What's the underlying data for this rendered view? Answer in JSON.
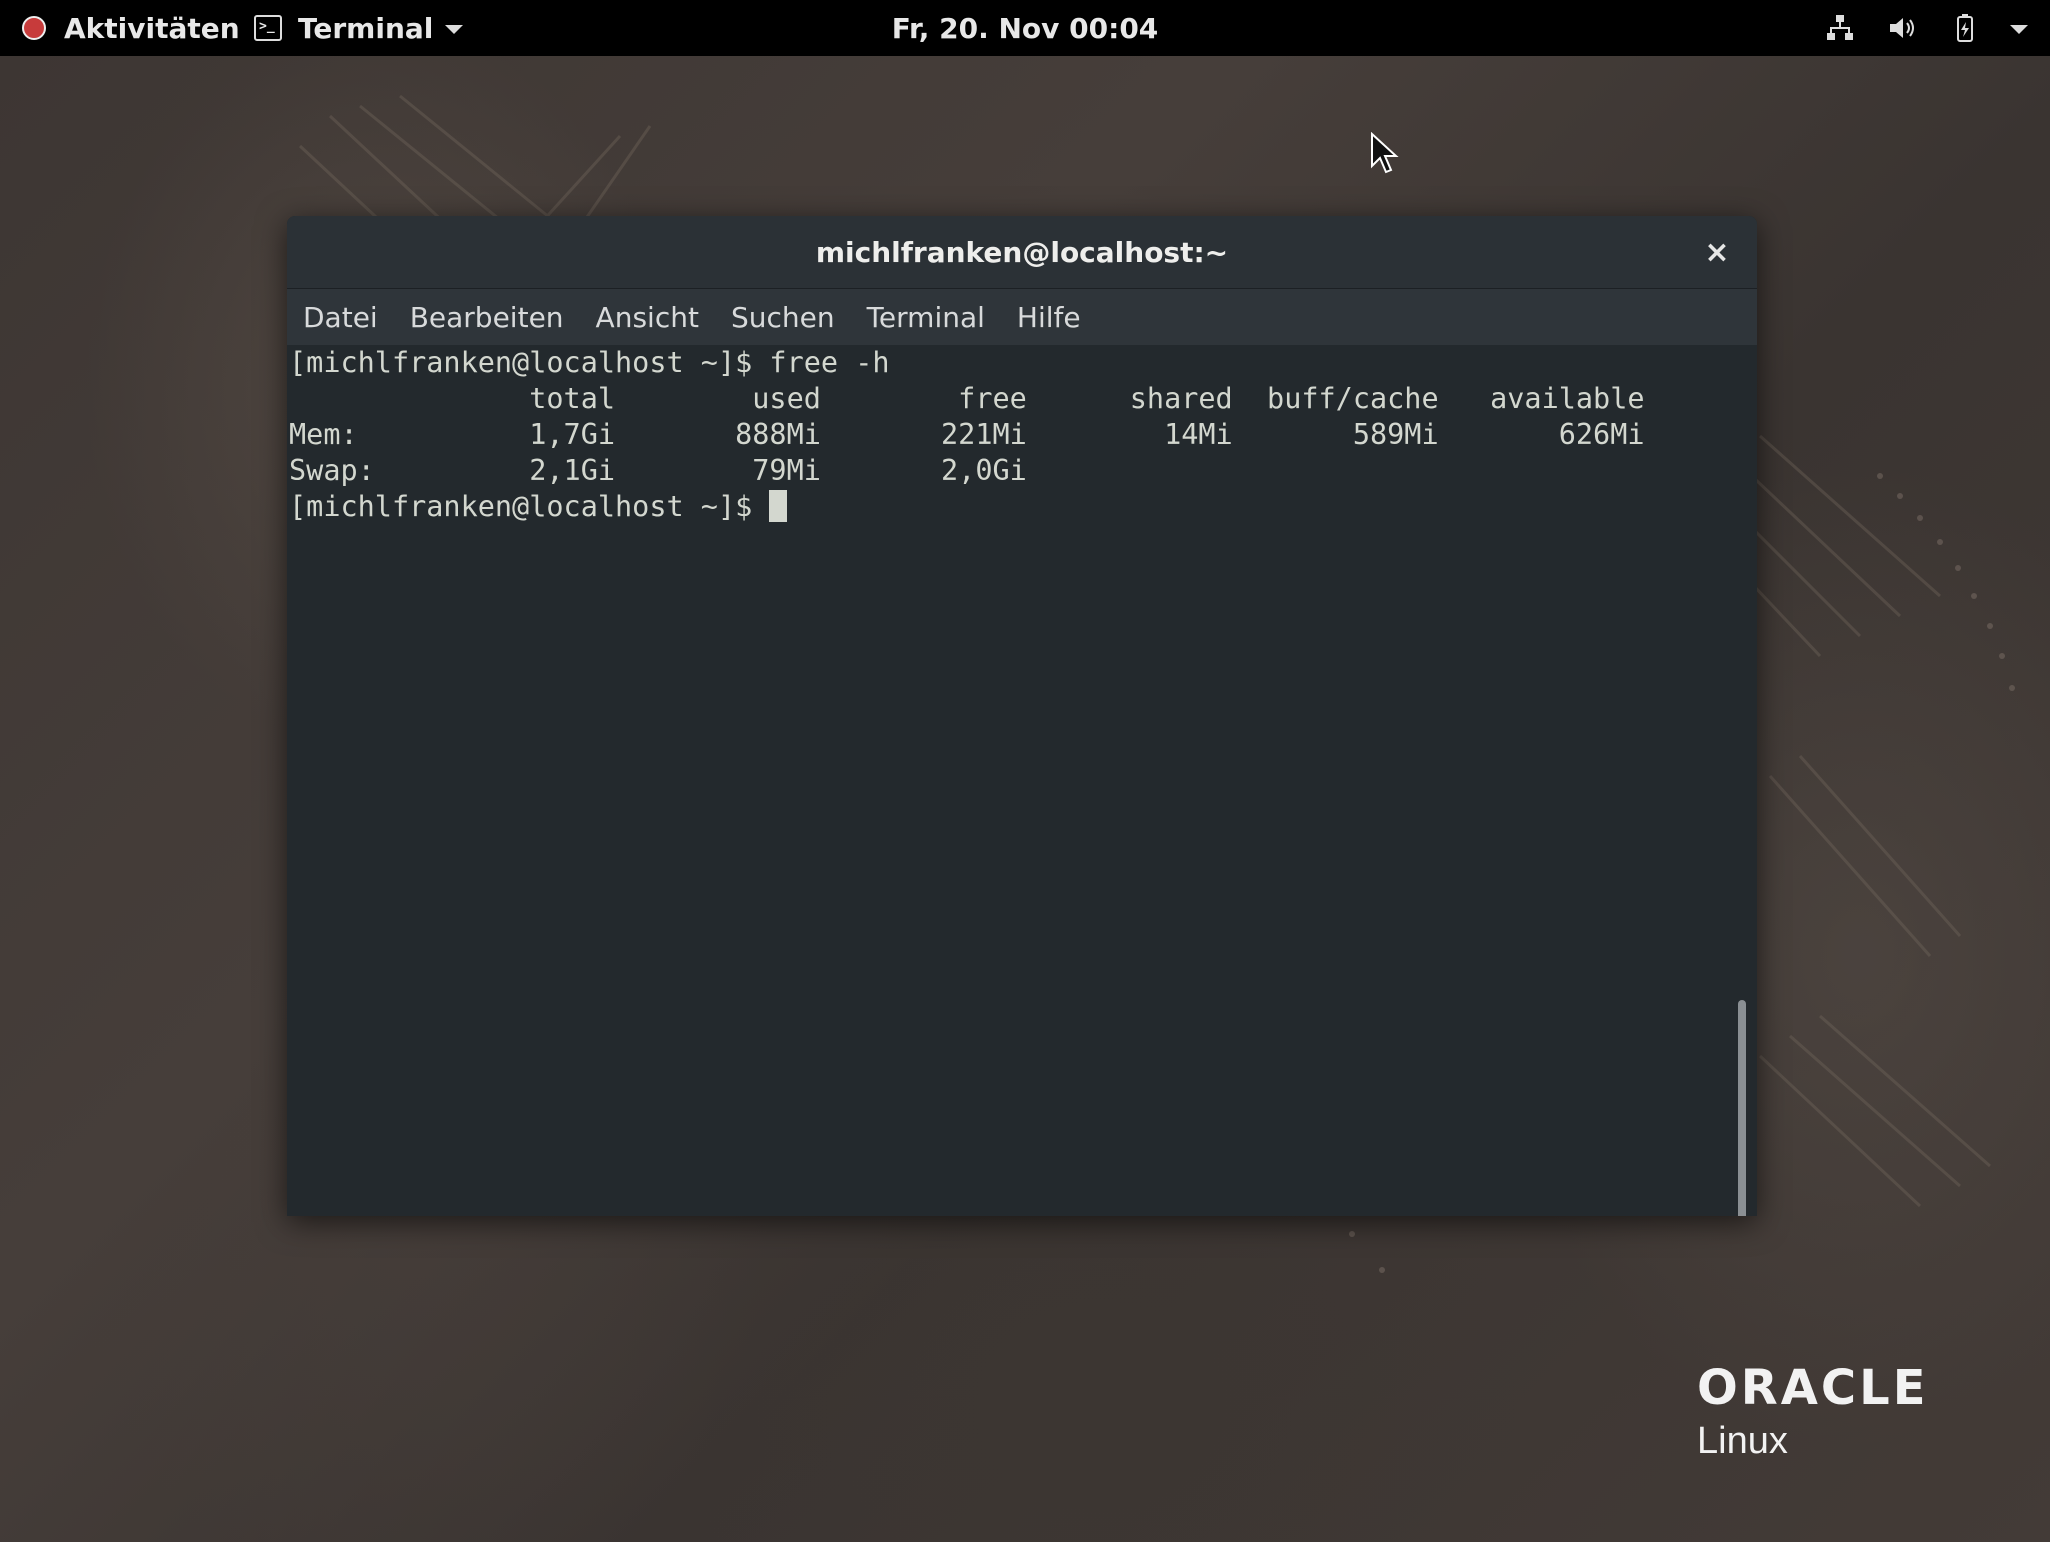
{
  "topbar": {
    "activities_label": "Aktivitäten",
    "app_menu_label": "Terminal",
    "clock": "Fr, 20. Nov  00:04"
  },
  "window": {
    "title": "michlfranken@localhost:~",
    "close_symbol": "×",
    "menu": {
      "datei": "Datei",
      "bearbeiten": "Bearbeiten",
      "ansicht": "Ansicht",
      "suchen": "Suchen",
      "terminal": "Terminal",
      "hilfe": "Hilfe"
    }
  },
  "terminal": {
    "lines": [
      "[michlfranken@localhost ~]$ free -h",
      "              total        used        free      shared  buff/cache   available",
      "Mem:          1,7Gi       888Mi       221Mi        14Mi       589Mi       626Mi",
      "Swap:         2,1Gi        79Mi       2,0Gi",
      "[michlfranken@localhost ~]$ "
    ]
  },
  "logo": {
    "word": "ORACLE",
    "sub": "Linux"
  },
  "icons": {
    "network": "network-icon",
    "volume": "volume-icon",
    "battery": "battery-icon",
    "system_menu": "chevron-down-icon",
    "close": "close-icon"
  }
}
